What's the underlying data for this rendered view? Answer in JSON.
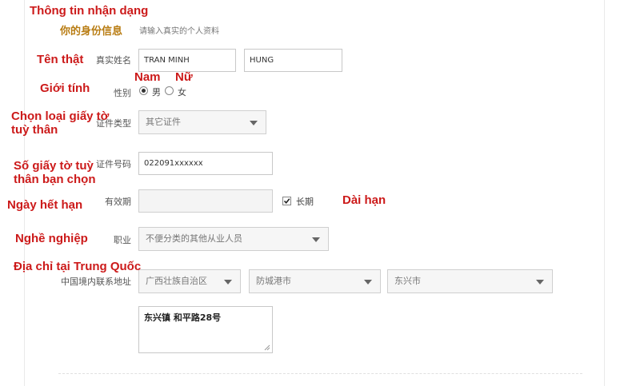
{
  "annotations": {
    "identity_info": "Thông tin nhận dạng",
    "real_name": "Tên thật",
    "male": "Nam",
    "female": "Nữ",
    "gender": "Giới tính",
    "id_type": "Chọn loại giấy tờ tuỳ thân",
    "id_number": "Số giấy tờ tuỳ thân bạn chọn",
    "expiry": "Ngày hết hạn",
    "long_term": "Dài hạn",
    "occupation": "Nghề nghiệp",
    "china_address": "Địa chỉ tại Trung Quốc"
  },
  "section": {
    "title": "你的身份信息",
    "subtitle": "请输入真实的个人资料"
  },
  "form": {
    "name_label": "真实姓名",
    "surname_value": "TRAN MINH",
    "given_name_value": "HUNG",
    "gender_label": "性别",
    "male_label": "男",
    "female_label": "女",
    "gender_selected": "男",
    "id_type_label": "证件类型",
    "id_type_value": "其它证件",
    "id_number_label": "证件号码",
    "id_number_value": "022091xxxxxx",
    "validity_label": "有效期",
    "validity_value": "",
    "long_term_label": "长期",
    "long_term_checked": true,
    "occupation_label": "职业",
    "occupation_value": "不便分类的其他从业人员",
    "address_label": "中国境内联系地址",
    "province_value": "广西壮族自治区",
    "city_value": "防城港市",
    "district_value": "东兴市",
    "street_value": "东兴镇 和平路28号"
  },
  "icons": {
    "select_caret": "chevron-down-icon",
    "checkmark": "check-icon",
    "textarea_grip": "resize-grip-icon"
  },
  "colors": {
    "annotation": "#cc1a1a",
    "section_title": "#b87c12"
  }
}
